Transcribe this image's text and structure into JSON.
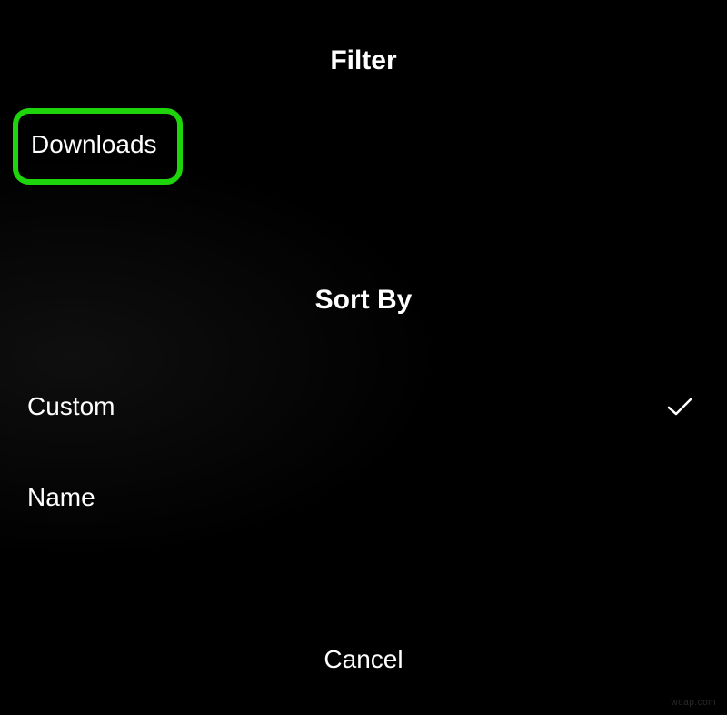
{
  "headers": {
    "filter": "Filter",
    "sort": "Sort By"
  },
  "filter": {
    "options": [
      {
        "label": "Downloads",
        "highlighted": true
      }
    ]
  },
  "sort": {
    "options": [
      {
        "label": "Custom",
        "selected": true
      },
      {
        "label": "Name",
        "selected": false
      }
    ]
  },
  "actions": {
    "cancel": "Cancel"
  },
  "watermark": "woap.com",
  "colors": {
    "highlight_border": "#1ed40b",
    "background": "#000000",
    "text": "#ffffff"
  }
}
